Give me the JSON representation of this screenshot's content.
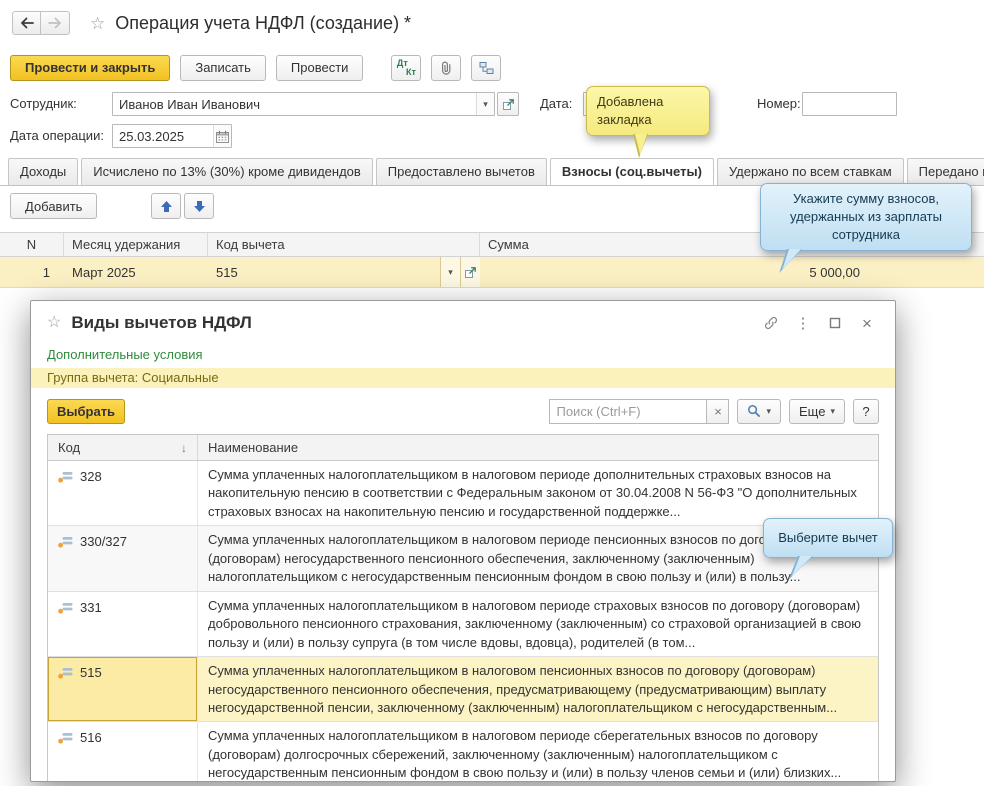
{
  "titlebar": {
    "title": "Операция учета НДФЛ (создание) *"
  },
  "toolbar": {
    "post_and_close": "Провести и закрыть",
    "save": "Записать",
    "post": "Провести",
    "dt": "Дт",
    "kt": "Кт"
  },
  "form": {
    "employee_label": "Сотрудник:",
    "employee_value": "Иванов Иван Иванович",
    "date_label": "Дата:",
    "number_label": "Номер:",
    "operation_date_label": "Дата операции:",
    "operation_date_value": "25.03.2025"
  },
  "tabs": [
    {
      "label": "Доходы"
    },
    {
      "label": "Исчислено по 13% (30%) кроме дивидендов"
    },
    {
      "label": "Предоставлено вычетов"
    },
    {
      "label": "Взносы (соц.вычеты)"
    },
    {
      "label": "Удержано по всем ставкам"
    },
    {
      "label": "Передано в н"
    }
  ],
  "grid": {
    "add_button": "Добавить",
    "columns": {
      "n": "N",
      "month": "Месяц удержания",
      "code": "Код вычета",
      "sum": "Сумма"
    },
    "row": {
      "n": "1",
      "month": "Март 2025",
      "code": "515",
      "sum": "5 000,00"
    }
  },
  "callouts": {
    "bookmark": "Добавлена закладка",
    "sum_hint": "Укажите сумму взносов, удержанных из зарплаты сотрудника",
    "select_hint": "Выберите вычет"
  },
  "dialog": {
    "title": "Виды вычетов НДФЛ",
    "additional_conditions": "Дополнительные условия",
    "group_filter": "Группа вычета: Социальные",
    "select_button": "Выбрать",
    "search_placeholder": "Поиск (Ctrl+F)",
    "more_button": "Еще",
    "help_button": "?",
    "columns": {
      "code": "Код",
      "name": "Наименование"
    },
    "rows": [
      {
        "code": "328",
        "name": "Сумма уплаченных налогоплательщиком в налоговом периоде дополнительных страховых взносов на накопительную пенсию в соответствии с Федеральным законом от 30.04.2008 N 56-ФЗ \"О дополнительных страховых взносах на накопительную пенсию и государственной поддержке..."
      },
      {
        "code": "330/327",
        "name": "Сумма уплаченных налогоплательщиком в налоговом периоде пенсионных взносов по договору (договорам) негосударственного пенсионного обеспечения, заключенному (заключенным) налогоплательщиком с негосударственным пенсионным фондом в свою пользу и (или) в пользу..."
      },
      {
        "code": "331",
        "name": "Сумма уплаченных налогоплательщиком в налоговом периоде страховых взносов по договору (договорам) добровольного пенсионного страхования, заключенному (заключенным) со страховой организацией в свою пользу и (или) в пользу супруга (в том числе вдовы, вдовца), родителей (в том..."
      },
      {
        "code": "515",
        "name": "Сумма уплаченных налогоплательщиком в налоговом пенсионных взносов по договору (договорам) негосударственного пенсионного обеспечения, предусматривающему (предусматривающим) выплату негосударственной пенсии, заключенному (заключенным) налогоплательщиком с негосударственным..."
      },
      {
        "code": "516",
        "name": "Сумма уплаченных налогоплательщиком в налоговом периоде сберегательных взносов по договору (договорам) долгосрочных сбережений, заключенному (заключенным) налогоплательщиком с негосударственным пенсионным фондом в свою пользу и (или) в пользу членов семьи и (или) близких..."
      }
    ]
  },
  "icons": {
    "star": "☆",
    "caret": "▾",
    "close": "×",
    "clear": "×",
    "dots": "⋮",
    "sort_down": "↓"
  },
  "colors": {
    "accent_yellow": "#f2c222",
    "selection_yellow": "#fbf0c3",
    "callout_blue": "#cfe9f8",
    "callout_yellow": "#f8ef92"
  }
}
